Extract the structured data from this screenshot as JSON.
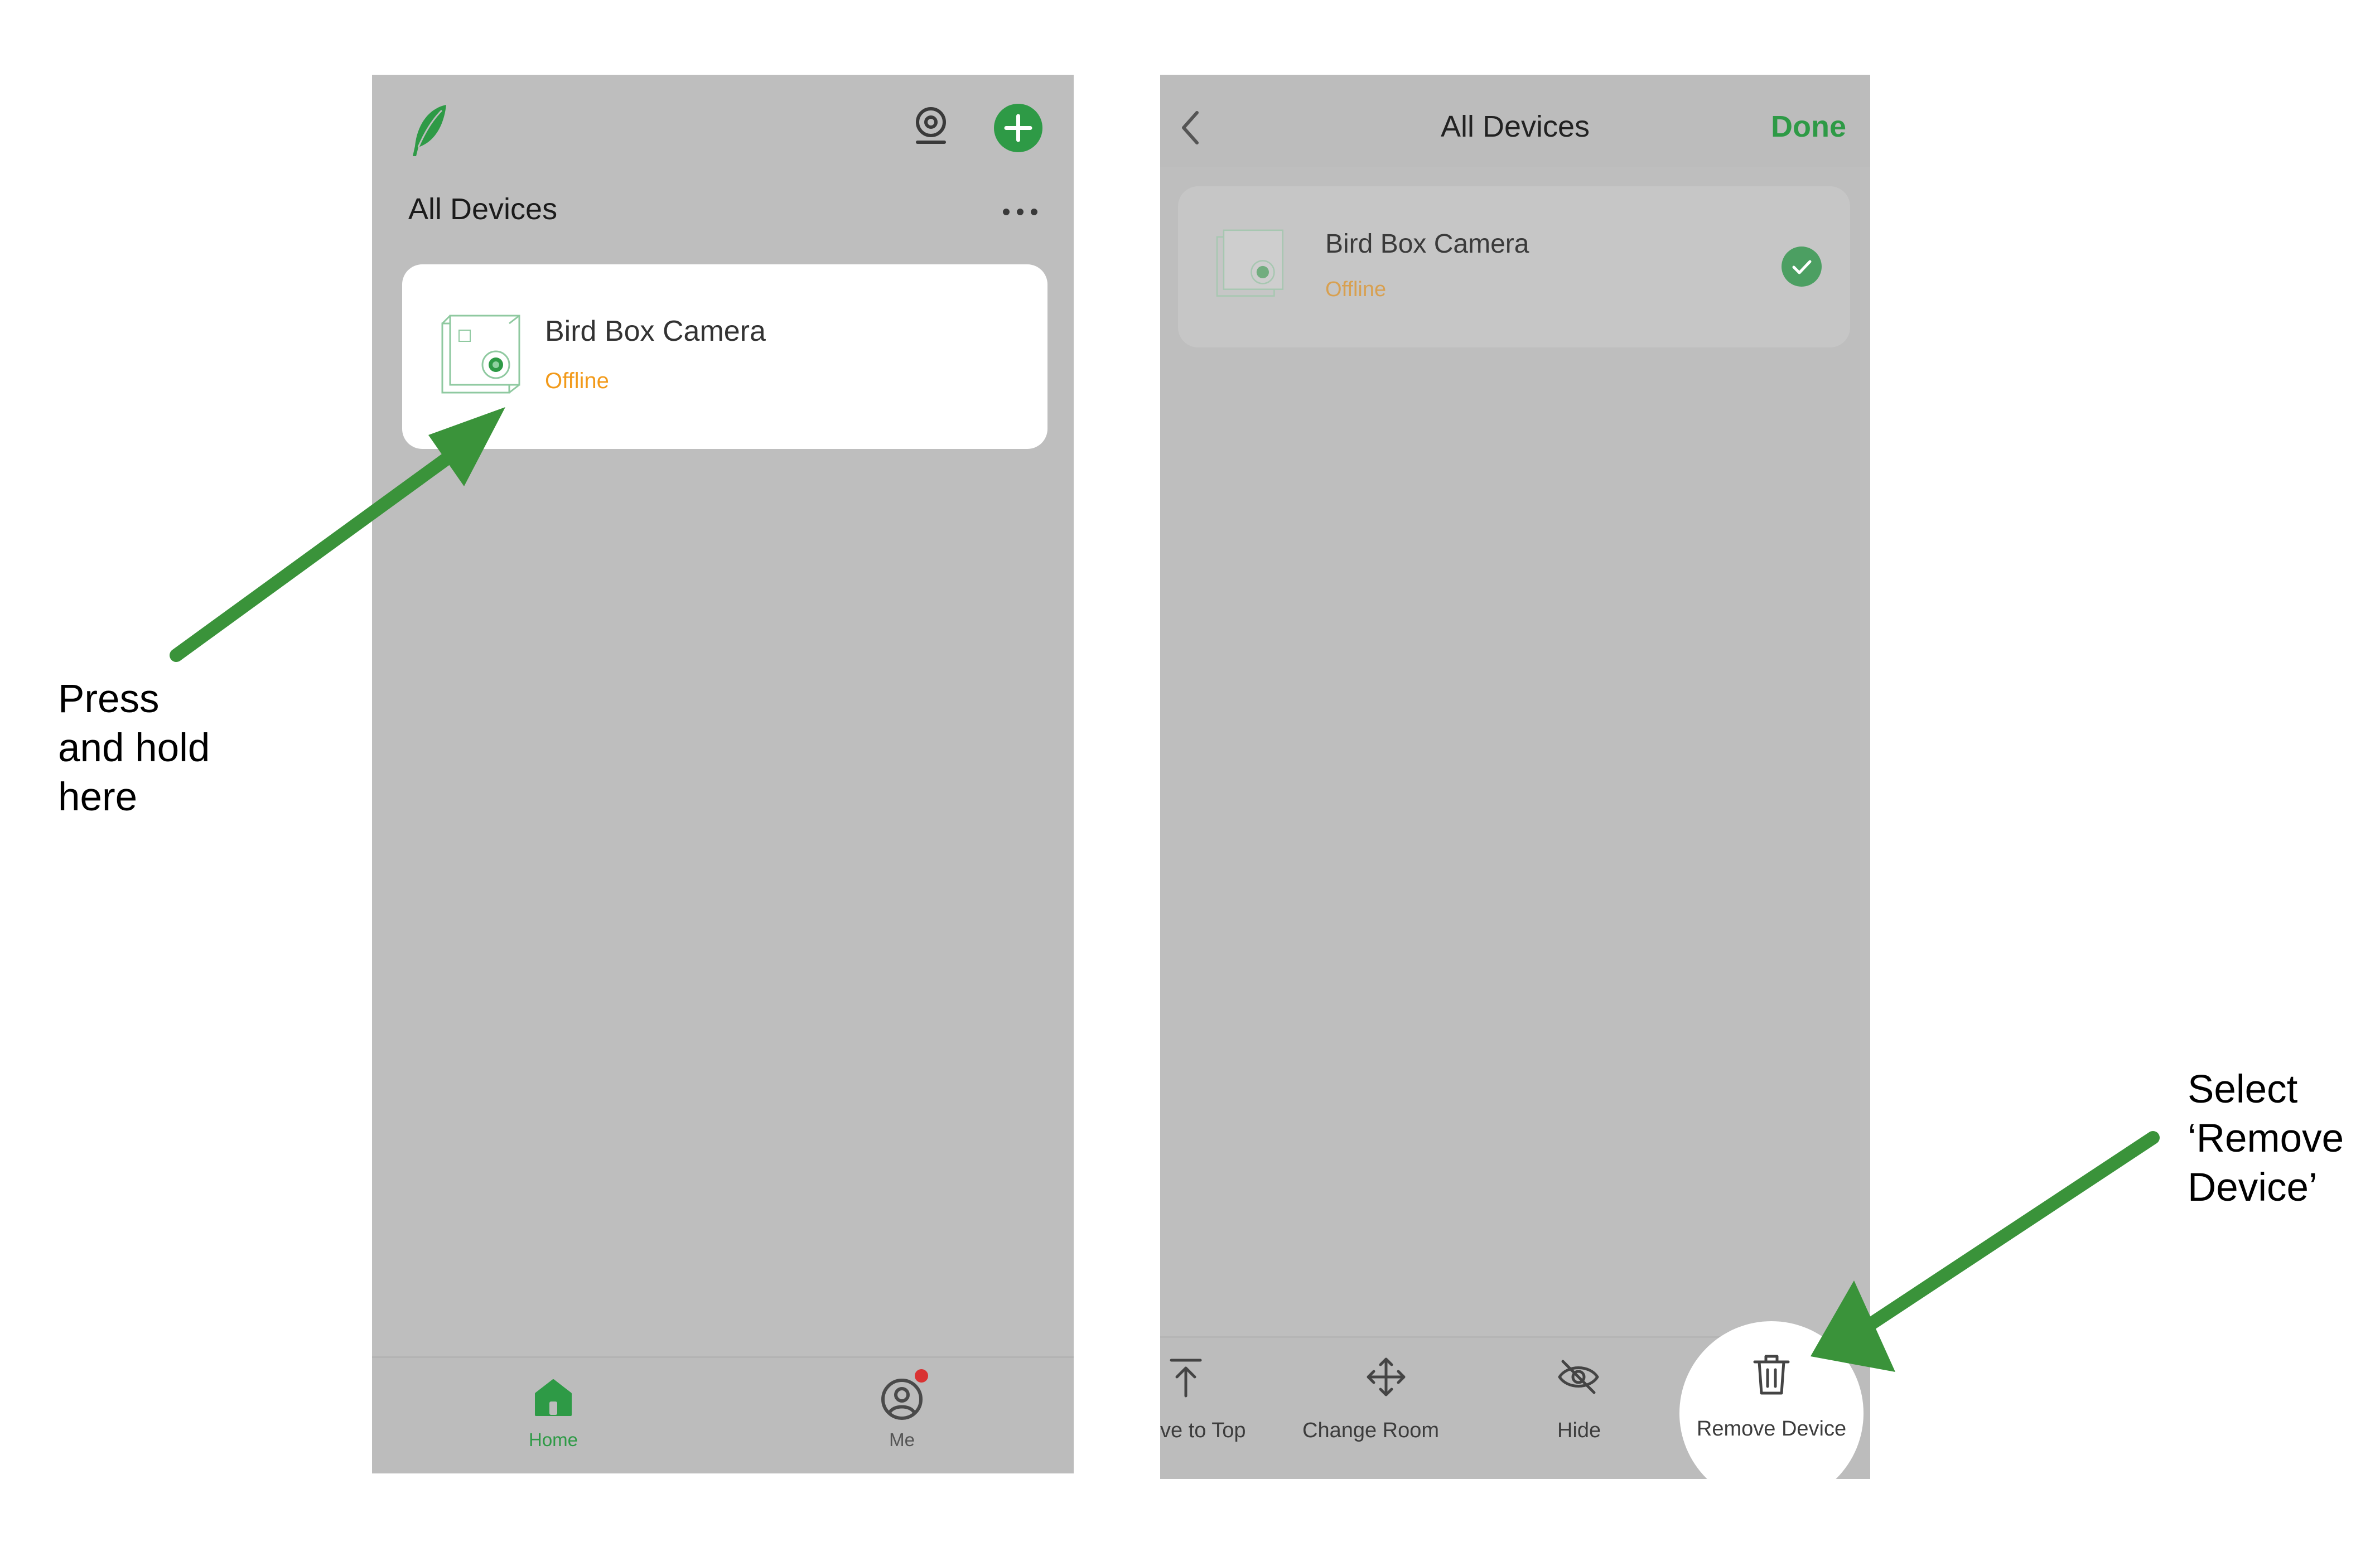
{
  "left_screen": {
    "header": {
      "logo_icon": "feather-icon",
      "camera_icon": "camera-icon",
      "add_icon": "plus-icon"
    },
    "section_title": "All Devices",
    "more_icon": "more-dots-icon",
    "device": {
      "name": "Bird Box Camera",
      "status": "Offline",
      "thumb_icon": "bird-box-camera-icon"
    },
    "tabbar": {
      "home_label": "Home",
      "me_label": "Me"
    }
  },
  "right_screen": {
    "header": {
      "title": "All Devices",
      "done_label": "Done",
      "back_icon": "chevron-left-icon"
    },
    "device": {
      "name": "Bird Box Camera",
      "status": "Offline",
      "selected": true
    },
    "toolbar": [
      {
        "label": "ve to Top",
        "icon": "move-to-top-icon"
      },
      {
        "label": "Change Room",
        "icon": "move-arrows-icon"
      },
      {
        "label": "Hide",
        "icon": "eye-slash-icon"
      },
      {
        "label": "Remove Device",
        "icon": "trash-icon"
      }
    ]
  },
  "annotations": {
    "left": [
      "Press",
      "and hold",
      "here"
    ],
    "right": [
      "Select",
      "‘Remove",
      "Device’"
    ]
  },
  "colors": {
    "accent_green": "#2e9a46",
    "status_orange": "#f29a1a",
    "arrow_green": "#3a933a",
    "screen_gray": "#bebebe"
  }
}
